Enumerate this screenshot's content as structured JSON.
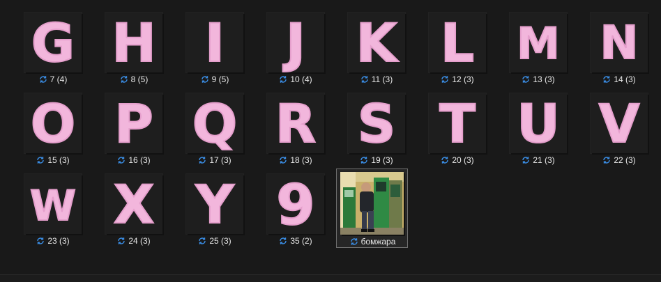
{
  "files": [
    {
      "glyph": "G",
      "label": "7 (4)"
    },
    {
      "glyph": "H",
      "label": "8 (5)"
    },
    {
      "glyph": "I",
      "label": "9 (5)"
    },
    {
      "glyph": "J",
      "label": "10 (4)"
    },
    {
      "glyph": "K",
      "label": "11 (3)"
    },
    {
      "glyph": "L",
      "label": "12 (3)"
    },
    {
      "glyph": "M",
      "label": "13 (3)"
    },
    {
      "glyph": "N",
      "label": "14 (3)"
    },
    {
      "glyph": "O",
      "label": "15 (3)"
    },
    {
      "glyph": "P",
      "label": "16 (3)"
    },
    {
      "glyph": "Q",
      "label": "17 (3)"
    },
    {
      "glyph": "R",
      "label": "18 (3)"
    },
    {
      "glyph": "S",
      "label": "19 (3)"
    },
    {
      "glyph": "T",
      "label": "20 (3)"
    },
    {
      "glyph": "U",
      "label": "21 (3)"
    },
    {
      "glyph": "V",
      "label": "22 (3)"
    },
    {
      "glyph": "W",
      "label": "23 (3)"
    },
    {
      "glyph": "X",
      "label": "24 (3)"
    },
    {
      "glyph": "Y",
      "label": "25 (3)"
    },
    {
      "glyph": "9",
      "label": "35 (2)"
    },
    {
      "glyph": "",
      "label": "бомжара",
      "photo": true
    }
  ],
  "colors": {
    "background": "#191919",
    "thumb": "#1e1e1e",
    "letter": "#f2b6dc",
    "sync_icon": "#3a8ee6",
    "text": "#e8e8e8"
  },
  "icons": {
    "status": "sync-icon"
  }
}
